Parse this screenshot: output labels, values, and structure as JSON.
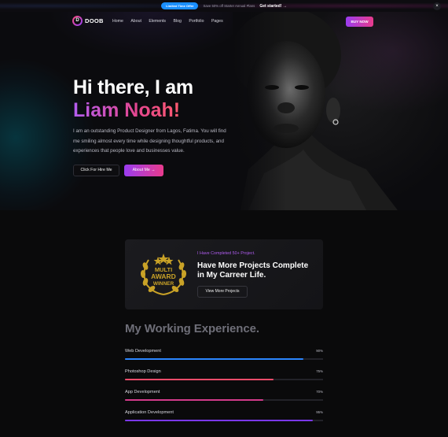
{
  "promo": {
    "badge": "Limited Time Offer",
    "text": "Save 50% off Starter Annual Plans",
    "link": "Get started! →",
    "close": "×"
  },
  "header": {
    "logo": "DOOB",
    "nav": [
      "Home",
      "About",
      "Elements",
      "Blog",
      "Portfolio",
      "Pages"
    ],
    "buy_label": "BUY NOW"
  },
  "hero": {
    "title": "Hi there, I am",
    "name": "Liam Noah!",
    "description": "I am an outstanding Product Designer from Lagos, Fatima. You will find me smiling almost every time while designing thoughtful products, and experiences that people love and businesses value.",
    "hire_label": "Click For Hire Me",
    "about_label": "About Me →"
  },
  "projects_card": {
    "badge_text": [
      "MULTI",
      "AWARD",
      "WINNER"
    ],
    "tag": "I Have Completed 50+ Project.",
    "title": "Have More Projects Complete in My Carreer Life.",
    "button": "View More Projects"
  },
  "experience": {
    "title": "My Working Experience.",
    "skills": [
      {
        "name": "Web Development",
        "percent_label": "90%",
        "percent": 90,
        "color": "#2b86ff"
      },
      {
        "name": "Photoshop Design",
        "percent_label": "75%",
        "percent": 75,
        "color": "#ef4c6a"
      },
      {
        "name": "App Development",
        "percent_label": "70%",
        "percent": 70,
        "color": "#d23b8b"
      },
      {
        "name": "Application Development",
        "percent_label": "95%",
        "percent": 95,
        "color": "#7a38e8"
      }
    ]
  },
  "colors": {
    "accent_gradient_start": "#9a3cf0",
    "accent_gradient_end": "#e93b8c",
    "background": "#0a0a0b"
  }
}
